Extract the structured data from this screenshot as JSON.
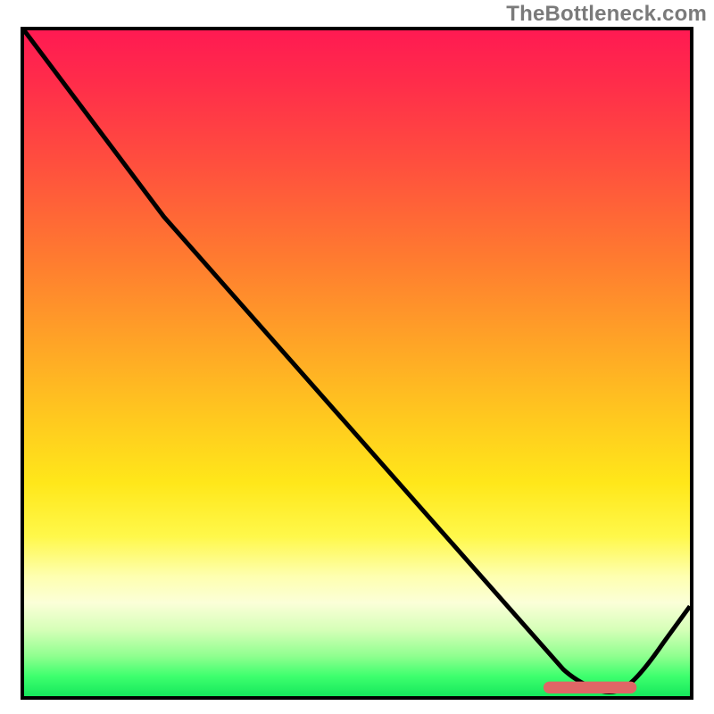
{
  "watermark": "TheBottleneck.com",
  "chart_data": {
    "type": "line",
    "title": "",
    "xlabel": "",
    "ylabel": "",
    "x_range_normalized": [
      0,
      1
    ],
    "y_range_normalized": [
      0,
      1
    ],
    "series": [
      {
        "name": "curve",
        "x_norm": [
          0.0,
          0.21,
          0.81,
          0.83,
          0.88,
          0.92,
          1.0
        ],
        "y_norm": [
          1.0,
          0.72,
          0.04,
          0.022,
          0.0,
          0.022,
          0.135
        ]
      }
    ],
    "marker": {
      "name": "optimal-range-bar",
      "x_norm_start": 0.78,
      "x_norm_end": 0.92,
      "y_norm": 0.012,
      "color": "#e06666"
    },
    "gradient_stops": [
      {
        "pos": 0.0,
        "color": "#ff1a52"
      },
      {
        "pos": 0.34,
        "color": "#ff7a30"
      },
      {
        "pos": 0.68,
        "color": "#ffe71a"
      },
      {
        "pos": 0.86,
        "color": "#fbffd8"
      },
      {
        "pos": 1.0,
        "color": "#16e85c"
      }
    ]
  }
}
